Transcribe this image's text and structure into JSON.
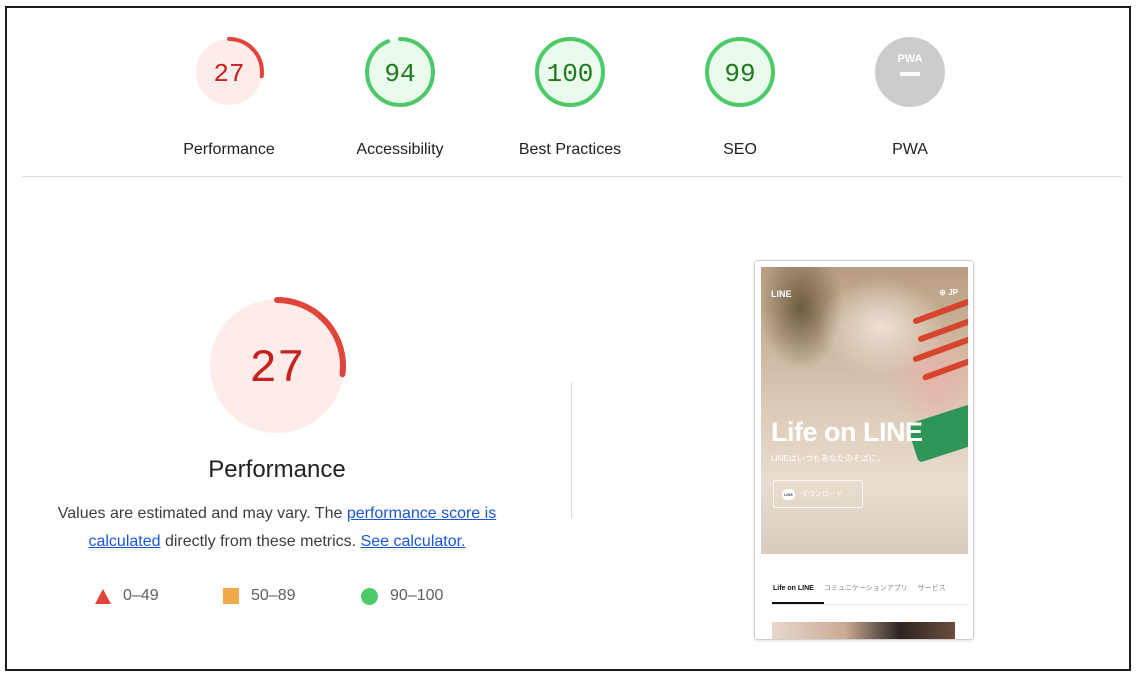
{
  "colors": {
    "fail": "#e0453a",
    "fail_text": "#c5221f",
    "fail_bg": "#fdecea",
    "average": "#f2a94a",
    "pass": "#4cc968",
    "pass_text": "#1f7a1f",
    "pass_bg": "#eafaec",
    "na": "#cccccc",
    "link": "#1a56d6"
  },
  "categories": [
    {
      "label": "Performance",
      "score": "27",
      "status": "fail",
      "fill": 0.27
    },
    {
      "label": "Accessibility",
      "score": "94",
      "status": "pass",
      "fill": 0.94
    },
    {
      "label": "Best Practices",
      "score": "100",
      "status": "pass",
      "fill": 1.0
    },
    {
      "label": "SEO",
      "score": "99",
      "status": "pass",
      "fill": 0.99
    },
    {
      "label": "PWA",
      "score": "PWA",
      "status": "na",
      "fill": 0
    }
  ],
  "detail": {
    "score": "27",
    "title": "Performance",
    "desc_before": "Values are estimated and may vary. The ",
    "desc_link1": "performance score is calculated",
    "desc_middle": " directly from these metrics. ",
    "desc_link2": "See calculator.",
    "legend": [
      {
        "icon": "triangle-icon",
        "range": "0–49"
      },
      {
        "icon": "square-icon",
        "range": "50–89"
      },
      {
        "icon": "circle-icon",
        "range": "90–100"
      }
    ]
  },
  "screenshot": {
    "logo": "LINE",
    "lang": "JP",
    "headline": "Life on LINE",
    "subline": "LINEはいつもあなたのそばに。",
    "button_badge": "LINE",
    "button_label": "ダウンロード",
    "tabs": [
      "Life on LINE",
      "コミュニケーションアプリ",
      "サービス"
    ]
  }
}
